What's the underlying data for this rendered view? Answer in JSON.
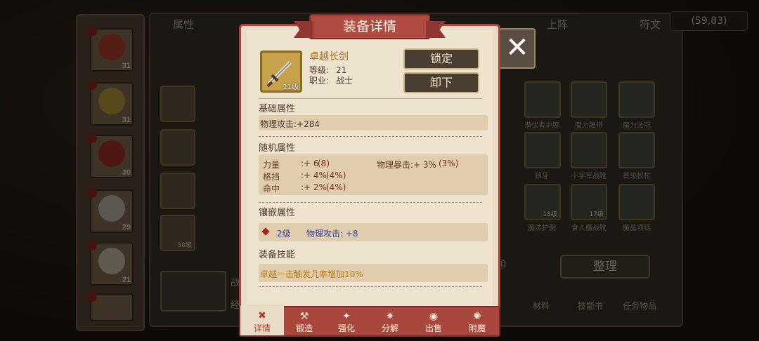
{
  "background": {
    "top_tabs": [
      "属性",
      "上阵",
      "符文"
    ],
    "coordinate": "(59,83)",
    "hero_levels": [
      "31",
      "31",
      "30",
      "29",
      "21"
    ],
    "left_slot_levels": [
      "",
      "",
      "",
      "30级"
    ],
    "left_texts": [
      "战",
      "经"
    ],
    "inventory_labels": [
      "潜伏者护腕",
      "魔力腰带",
      "魔力法冠",
      "狼牙",
      "十字军战靴",
      "首领权杖",
      "魔法护腕",
      "食人魔战靴",
      "魔晶项链"
    ],
    "inventory_levels": [
      "",
      "",
      "",
      "",
      "",
      "",
      "18级",
      "17级",
      ""
    ],
    "zero": "0",
    "tidy_button": "整理",
    "bottom_tabs": [
      "材料",
      "技能书",
      "任务物品"
    ]
  },
  "modal": {
    "title": "装备详情",
    "item": {
      "name": "卓越长剑",
      "level_badge": "21级",
      "level_label": "等级:",
      "level_value": "21",
      "class_label": "职业:",
      "class_value": "战士"
    },
    "buttons": {
      "lock": "锁定",
      "unequip": "卸下"
    },
    "base": {
      "title": "基础属性",
      "stat": "物理攻击:+284"
    },
    "random": {
      "title": "随机属性",
      "rows": [
        {
          "name": "力量",
          "value": ":+ 6",
          "extra": "(8)"
        },
        {
          "name": "格挡",
          "value": ":+ 4%",
          "extra": "(4%)"
        },
        {
          "name": "命中",
          "value": ":+ 2%",
          "extra": "(4%)"
        }
      ],
      "crit": {
        "label": "物理暴击:+ 3%",
        "extra": "(3%)"
      }
    },
    "inlay": {
      "title": "镶嵌属性",
      "level": "2级",
      "stat": "物理攻击: +8"
    },
    "skill": {
      "title": "装备技能",
      "text": "卓越一击触发几率增加10%"
    },
    "tabs": [
      {
        "label": "详情",
        "icon": "detail-icon"
      },
      {
        "label": "锻造",
        "icon": "forge-icon"
      },
      {
        "label": "强化",
        "icon": "enhance-icon"
      },
      {
        "label": "分解",
        "icon": "decompose-icon"
      },
      {
        "label": "出售",
        "icon": "sell-icon"
      },
      {
        "label": "附魔",
        "icon": "enchant-icon"
      }
    ]
  },
  "colors": {
    "ribbon": "#b14a41",
    "parchment": "#e8dcc6",
    "gold_text": "#c07a10",
    "red_text": "#8a2a22",
    "blue_text": "#3a3fa0"
  }
}
